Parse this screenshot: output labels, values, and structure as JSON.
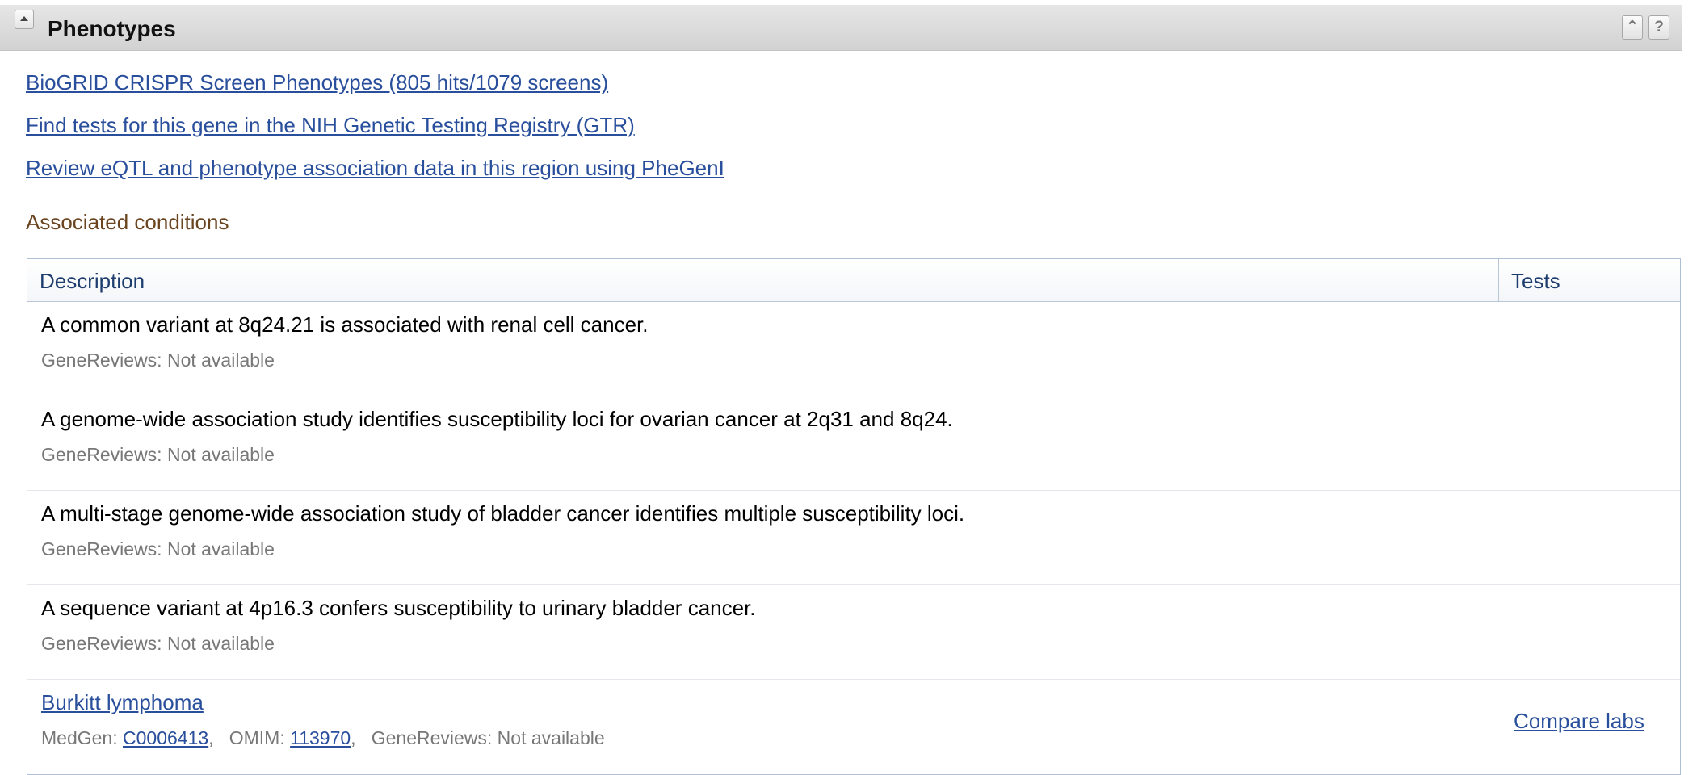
{
  "section": {
    "title": "Phenotypes",
    "collapse_icon": "caret-up-icon",
    "top_icon": "double-chevron-up-icon",
    "help_icon": "question-icon",
    "help_label": "?"
  },
  "links": [
    "BioGRID CRISPR Screen Phenotypes (805 hits/1079 screens)",
    "Find tests for this gene in the NIH Genetic Testing Registry (GTR)",
    "Review eQTL and phenotype association data in this region using PheGenI"
  ],
  "associated_conditions": {
    "heading": "Associated conditions",
    "columns": [
      "Description",
      "Tests"
    ],
    "rows": [
      {
        "title": "A common variant at 8q24.21 is associated with renal cell cancer.",
        "sub": "GeneReviews: Not available"
      },
      {
        "title": "A genome-wide association study identifies susceptibility loci for ovarian cancer at 2q31 and 8q24.",
        "sub": "GeneReviews: Not available"
      },
      {
        "title": "A multi-stage genome-wide association study of bladder cancer identifies multiple susceptibility loci.",
        "sub": "GeneReviews: Not available"
      },
      {
        "title": "A sequence variant at 4p16.3 confers susceptibility to urinary bladder cancer.",
        "sub": "GeneReviews: Not available"
      }
    ],
    "burkitt": {
      "title": "Burkitt lymphoma",
      "medgen_label": "MedGen: ",
      "medgen_id": "C0006413",
      "sep1": ",   ",
      "omim_label": "OMIM: ",
      "omim_id": "113970",
      "sep2": ",   ",
      "genereviews": "GeneReviews: Not available",
      "tests_link": "Compare labs"
    }
  },
  "colors": {
    "link": "#284e9c",
    "header_text": "#1d3d6e",
    "assoc_heading": "#6b4420"
  }
}
